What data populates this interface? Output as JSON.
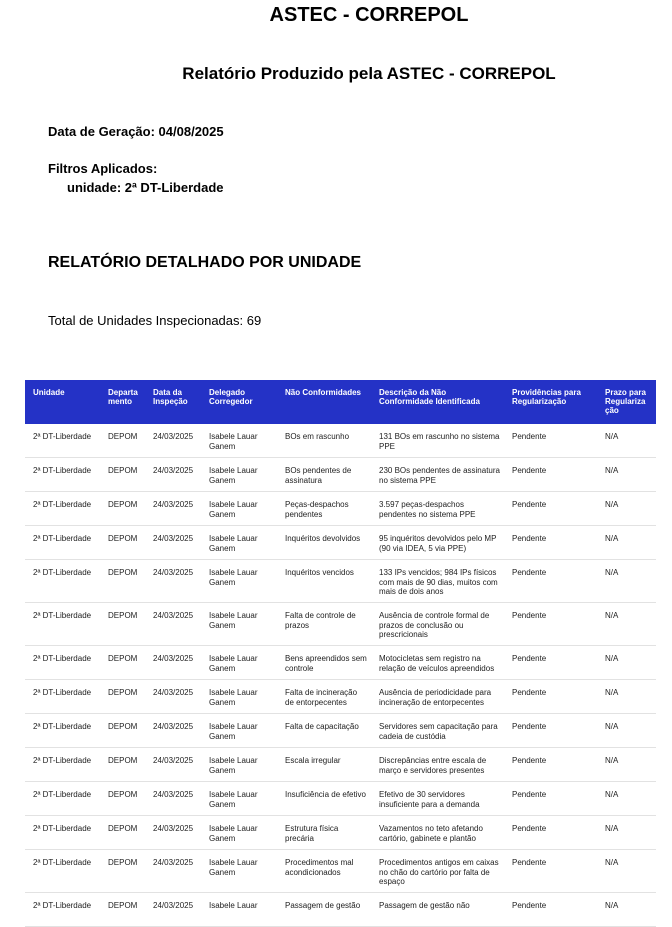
{
  "header": {
    "title": "ASTEC - CORREPOL",
    "subtitle": "Relatório Produzido pela ASTEC - CORREPOL"
  },
  "meta": {
    "generation": "Data de Geração: 04/08/2025",
    "filters_label": "Filtros Aplicados:",
    "filter_unit": "unidade: 2ª DT-Liberdade"
  },
  "section": {
    "title": "RELATÓRIO DETALHADO POR UNIDADE",
    "total": "Total de Unidades Inspecionadas: 69"
  },
  "table": {
    "columns": [
      "Unidade",
      "Departa mento",
      "Data da Inspeção",
      "Delegado Corregedor",
      "Não Conformidades",
      "Descrição da Não Conformidade Identificada",
      "Providências para Regularização",
      "Prazo para Regulariza ção"
    ],
    "rows": [
      [
        "2ª DT-Liberdade",
        "DEPOM",
        "24/03/2025",
        "Isabele Lauar Ganem",
        "BOs em rascunho",
        "131 BOs em rascunho no sistema PPE",
        "Pendente",
        "N/A"
      ],
      [
        "2ª DT-Liberdade",
        "DEPOM",
        "24/03/2025",
        "Isabele Lauar Ganem",
        "BOs pendentes de assinatura",
        "230 BOs pendentes de assinatura no sistema PPE",
        "Pendente",
        "N/A"
      ],
      [
        "2ª DT-Liberdade",
        "DEPOM",
        "24/03/2025",
        "Isabele Lauar Ganem",
        "Peças-despachos pendentes",
        "3.597 peças-despachos pendentes no sistema PPE",
        "Pendente",
        "N/A"
      ],
      [
        "2ª DT-Liberdade",
        "DEPOM",
        "24/03/2025",
        "Isabele Lauar Ganem",
        "Inquéritos devolvidos",
        "95 inquéritos devolvidos pelo MP (90 via IDEA, 5 via PPE)",
        "Pendente",
        "N/A"
      ],
      [
        "2ª DT-Liberdade",
        "DEPOM",
        "24/03/2025",
        "Isabele Lauar Ganem",
        "Inquéritos vencidos",
        "133 IPs vencidos; 984 IPs físicos com mais de 90 dias, muitos com mais de dois anos",
        "Pendente",
        "N/A"
      ],
      [
        "2ª DT-Liberdade",
        "DEPOM",
        "24/03/2025",
        "Isabele Lauar Ganem",
        "Falta de controle de prazos",
        "Ausência de controle formal de prazos de conclusão ou prescricionais",
        "Pendente",
        "N/A"
      ],
      [
        "2ª DT-Liberdade",
        "DEPOM",
        "24/03/2025",
        "Isabele Lauar Ganem",
        "Bens apreendidos sem controle",
        "Motocicletas sem registro na relação de veículos apreendidos",
        "Pendente",
        "N/A"
      ],
      [
        "2ª DT-Liberdade",
        "DEPOM",
        "24/03/2025",
        "Isabele Lauar Ganem",
        "Falta de incineração de entorpecentes",
        "Ausência de periodicidade para incineração de entorpecentes",
        "Pendente",
        "N/A"
      ],
      [
        "2ª DT-Liberdade",
        "DEPOM",
        "24/03/2025",
        "Isabele Lauar Ganem",
        "Falta de capacitação",
        "Servidores sem capacitação para cadeia de custódia",
        "Pendente",
        "N/A"
      ],
      [
        "2ª DT-Liberdade",
        "DEPOM",
        "24/03/2025",
        "Isabele Lauar Ganem",
        "Escala irregular",
        "Discrepâncias entre escala de março e servidores presentes",
        "Pendente",
        "N/A"
      ],
      [
        "2ª DT-Liberdade",
        "DEPOM",
        "24/03/2025",
        "Isabele Lauar Ganem",
        "Insuficiência de efetivo",
        "Efetivo de 30 servidores insuficiente para a demanda",
        "Pendente",
        "N/A"
      ],
      [
        "2ª DT-Liberdade",
        "DEPOM",
        "24/03/2025",
        "Isabele Lauar Ganem",
        "Estrutura física precária",
        "Vazamentos no teto afetando cartório, gabinete e plantão",
        "Pendente",
        "N/A"
      ],
      [
        "2ª DT-Liberdade",
        "DEPOM",
        "24/03/2025",
        "Isabele Lauar Ganem",
        "Procedimentos mal acondicionados",
        "Procedimentos antigos em caixas no chão do cartório por falta de espaço",
        "Pendente",
        "N/A"
      ],
      [
        "2ª DT-Liberdade",
        "DEPOM",
        "24/03/2025",
        "Isabele Lauar",
        "Passagem de gestão",
        "Passagem de gestão não",
        "Pendente",
        "N/A"
      ]
    ]
  },
  "colors": {
    "header_bg": "#2432c6",
    "header_text": "#ffffff",
    "row_border": "#e2e2e2"
  }
}
